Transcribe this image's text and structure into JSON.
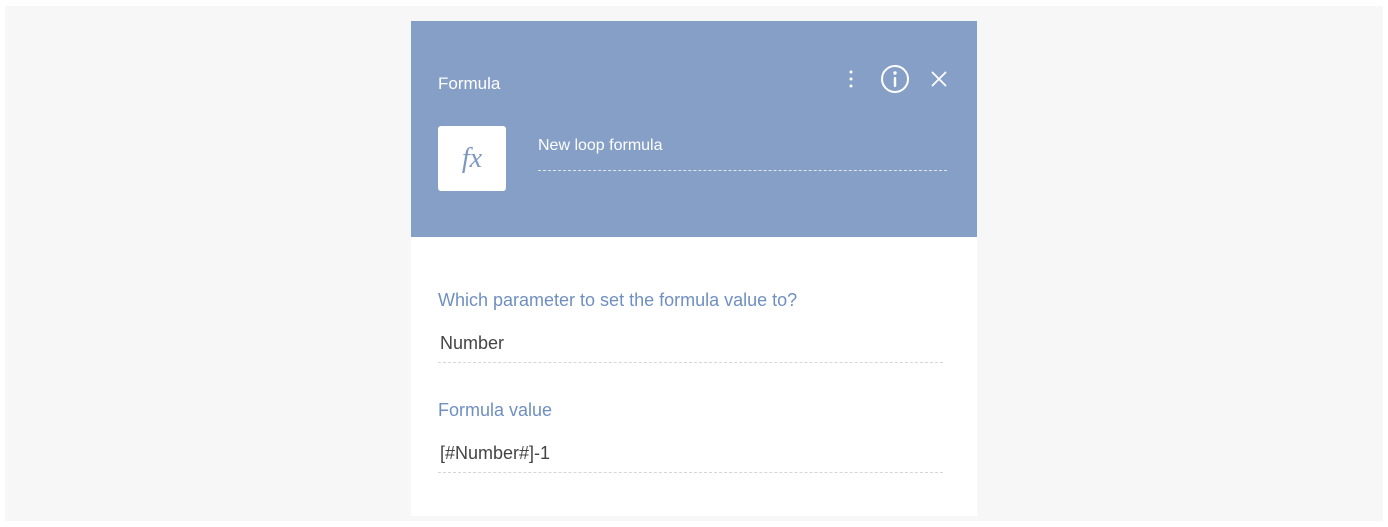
{
  "panel": {
    "title": "Formula",
    "element_name": "New loop formula",
    "element_icon_glyph": "fx",
    "header_color": "#859fc6",
    "actions": [
      {
        "name": "more-options",
        "icon": "kebab-menu-icon"
      },
      {
        "name": "info",
        "icon": "info-icon"
      },
      {
        "name": "close",
        "icon": "close-icon"
      }
    ]
  },
  "fields": {
    "parameter": {
      "label": "Which parameter to set the formula value to?",
      "value": "Number"
    },
    "formula": {
      "label": "Formula value",
      "value": "[#Number#]-1"
    }
  },
  "colors": {
    "label": "#6f8fc1",
    "value_text": "#444444"
  }
}
